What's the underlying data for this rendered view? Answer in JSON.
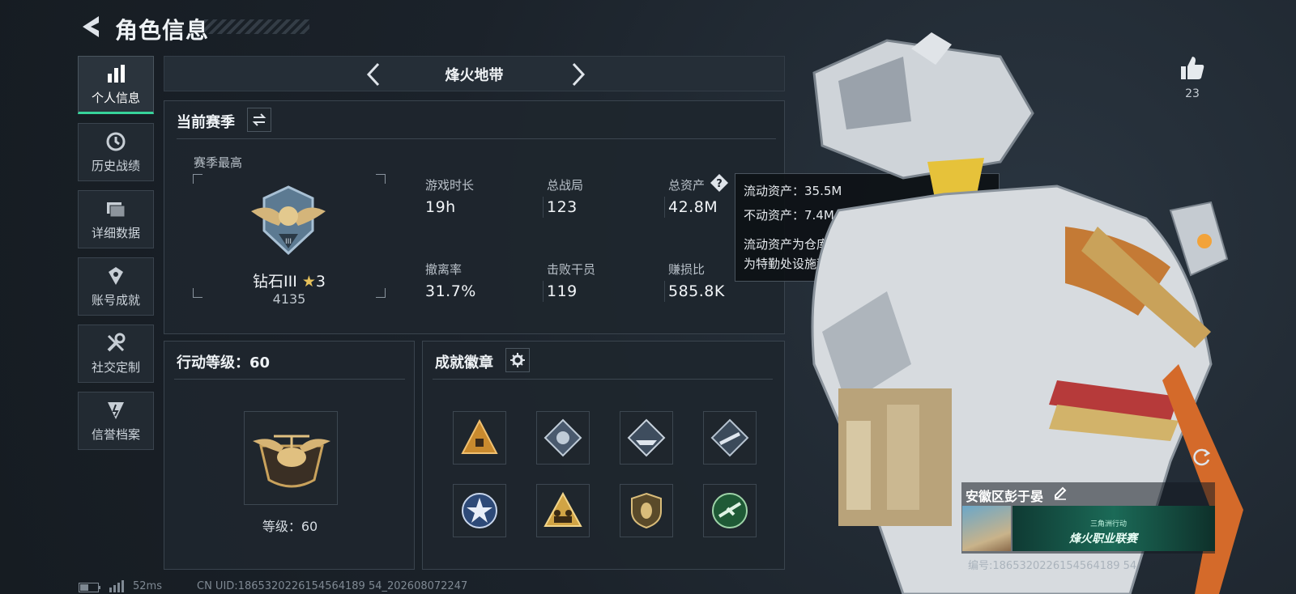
{
  "header": {
    "title": "角色信息"
  },
  "sidebar": {
    "items": [
      {
        "label": "个人信息",
        "icon": "bar-chart-icon",
        "active": true
      },
      {
        "label": "历史战绩",
        "icon": "history-icon",
        "active": false
      },
      {
        "label": "详细数据",
        "icon": "folder-icon",
        "active": false
      },
      {
        "label": "账号成就",
        "icon": "achievement-icon",
        "active": false
      },
      {
        "label": "社交定制",
        "icon": "tools-icon",
        "active": false
      },
      {
        "label": "信誉档案",
        "icon": "credit-icon",
        "active": false
      }
    ]
  },
  "mode_bar": {
    "mode": "烽火地带"
  },
  "season": {
    "title": "当前赛季",
    "best_label": "赛季最高",
    "rank_name": "钻石III",
    "rank_stars": "3",
    "rank_points": "4135",
    "stats": [
      {
        "label": "游戏时长",
        "value": "19h"
      },
      {
        "label": "总战局",
        "value": "123"
      },
      {
        "label": "总资产",
        "value": "42.8M"
      },
      {
        "label": "撤离率",
        "value": "31.7%"
      },
      {
        "label": "击败干员",
        "value": "119"
      },
      {
        "label": "赚损比",
        "value": "585.8K"
      }
    ]
  },
  "tooltip": {
    "liquid": "流动资产：35.5M",
    "fixed": "不动资产：7.4M",
    "desc_line1": "流动资产为仓库资产和哈夫币，不动资产",
    "desc_line2": "为特勤处设施和收藏室设施"
  },
  "level": {
    "title": "行动等级：60",
    "caption": "等级：60"
  },
  "badges": {
    "title": "成就徽章",
    "items": [
      {
        "icon": "pyramid-badge-icon",
        "color": "#c98a2e"
      },
      {
        "icon": "diamond-badge-icon",
        "color": "#9aa8b8"
      },
      {
        "icon": "ship-badge-icon",
        "color": "#b7c2cf"
      },
      {
        "icon": "rocket-badge-icon",
        "color": "#a9b6c4"
      },
      {
        "icon": "star-badge-icon",
        "color": "#7ea2d6"
      },
      {
        "icon": "soldiers-badge-icon",
        "color": "#d1a445"
      },
      {
        "icon": "shield-badge-icon",
        "color": "#b89a5a"
      },
      {
        "icon": "plane-badge-icon",
        "color": "#3e8a55"
      }
    ]
  },
  "player": {
    "likes": "23",
    "name": "安徽区彭于晏",
    "id_text": "编号:1865320226154564189 54",
    "banner_title": "烽火职业联赛",
    "banner_small": "三角洲行动"
  },
  "status_bar": {
    "ping": "52ms",
    "uid": "CN UID:1865320226154564189 54_202608072247"
  }
}
